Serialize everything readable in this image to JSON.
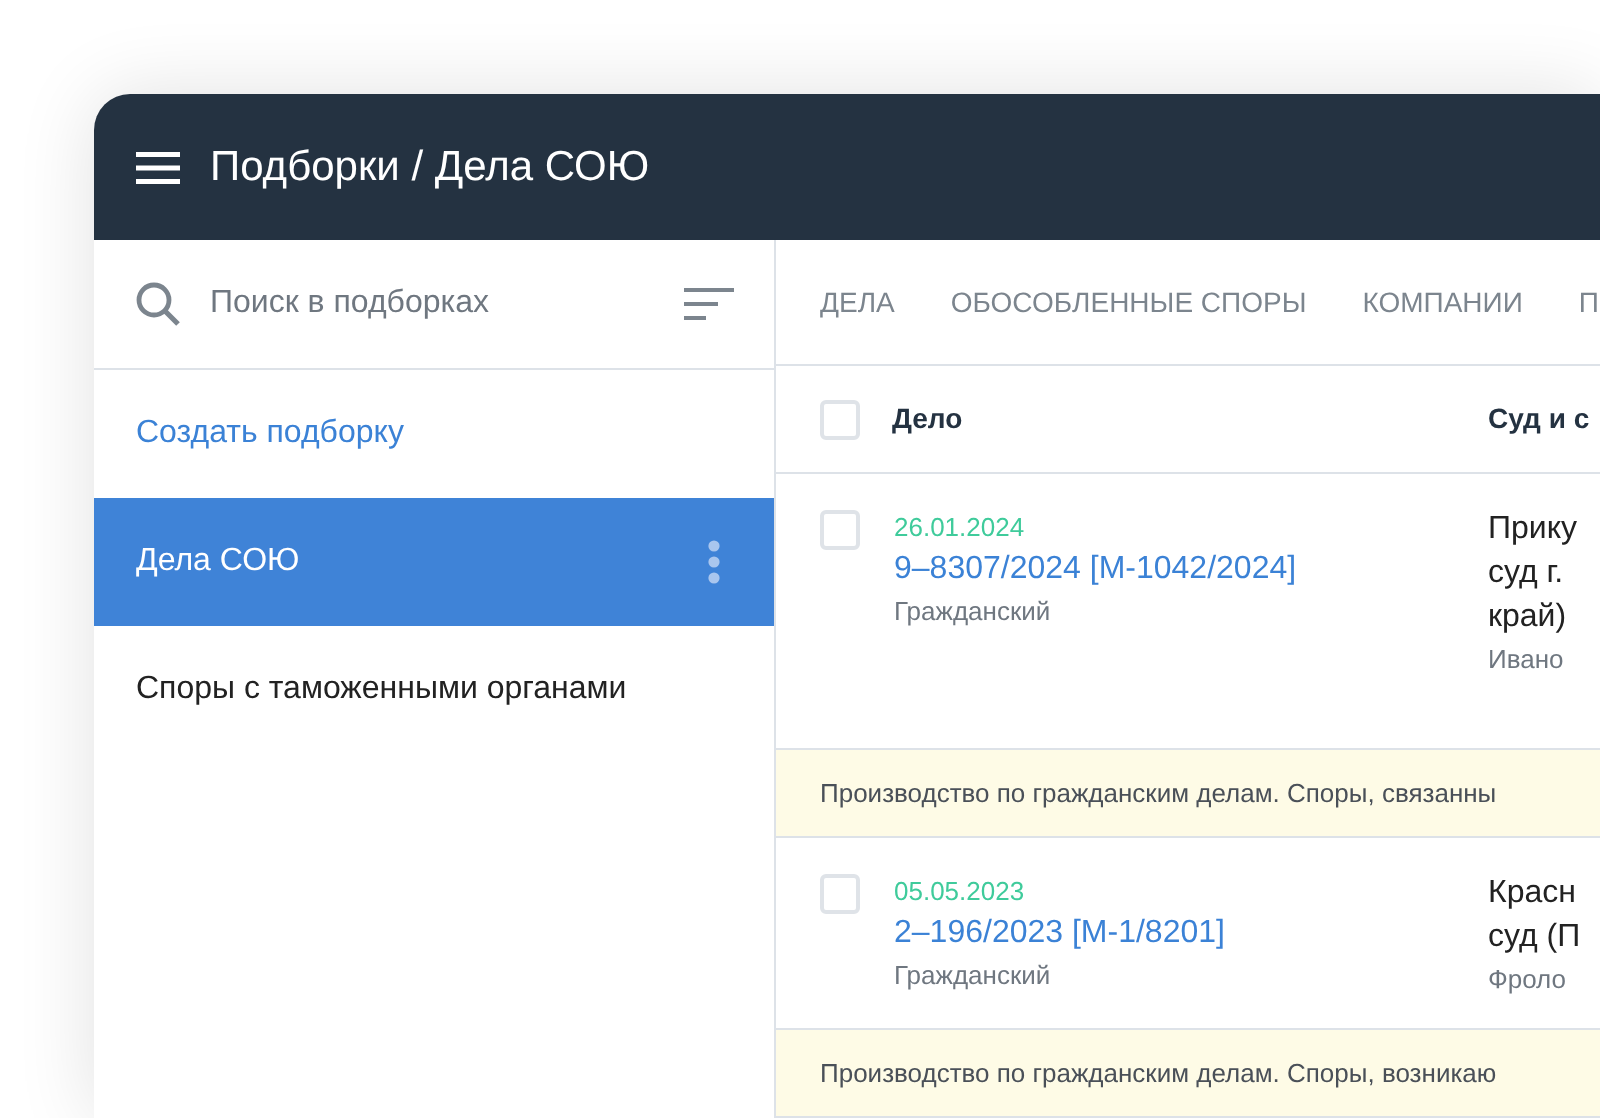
{
  "header": {
    "title": "Подборки / Дела СОЮ"
  },
  "sidebar": {
    "search": {
      "placeholder": "Поиск в подборках"
    },
    "create_link": "Создать подборку",
    "items": [
      {
        "label": "Дела СОЮ",
        "selected": true
      },
      {
        "label": "Споры с таможенными органами",
        "selected": false
      }
    ]
  },
  "tabs": [
    {
      "label": "ДЕЛА",
      "selected": false
    },
    {
      "label": "ОБОСОБЛЕННЫЕ СПОРЫ",
      "selected": false
    },
    {
      "label": "КОМПАНИИ",
      "selected": false
    },
    {
      "label": "П",
      "selected": false
    }
  ],
  "table": {
    "columns": [
      "Дело",
      "Суд и с"
    ],
    "header_checked": false,
    "rows": [
      {
        "checked": false,
        "date": "26.01.2024",
        "number": "9–8307/2024 [М-1042/2024]",
        "type": "Гражданский",
        "court": [
          "Прику",
          "суд г.",
          "край)"
        ],
        "judge": "Ивано",
        "note": "Производство по гражданским делам. Споры, связанны"
      },
      {
        "checked": false,
        "date": "05.05.2023",
        "number": "2–196/2023 [М-1/8201]",
        "type": "Гражданский",
        "court": [
          "Красн",
          "суд (П"
        ],
        "judge": "Фроло",
        "note": "Производство по гражданским делам. Споры, возникаю"
      }
    ]
  }
}
